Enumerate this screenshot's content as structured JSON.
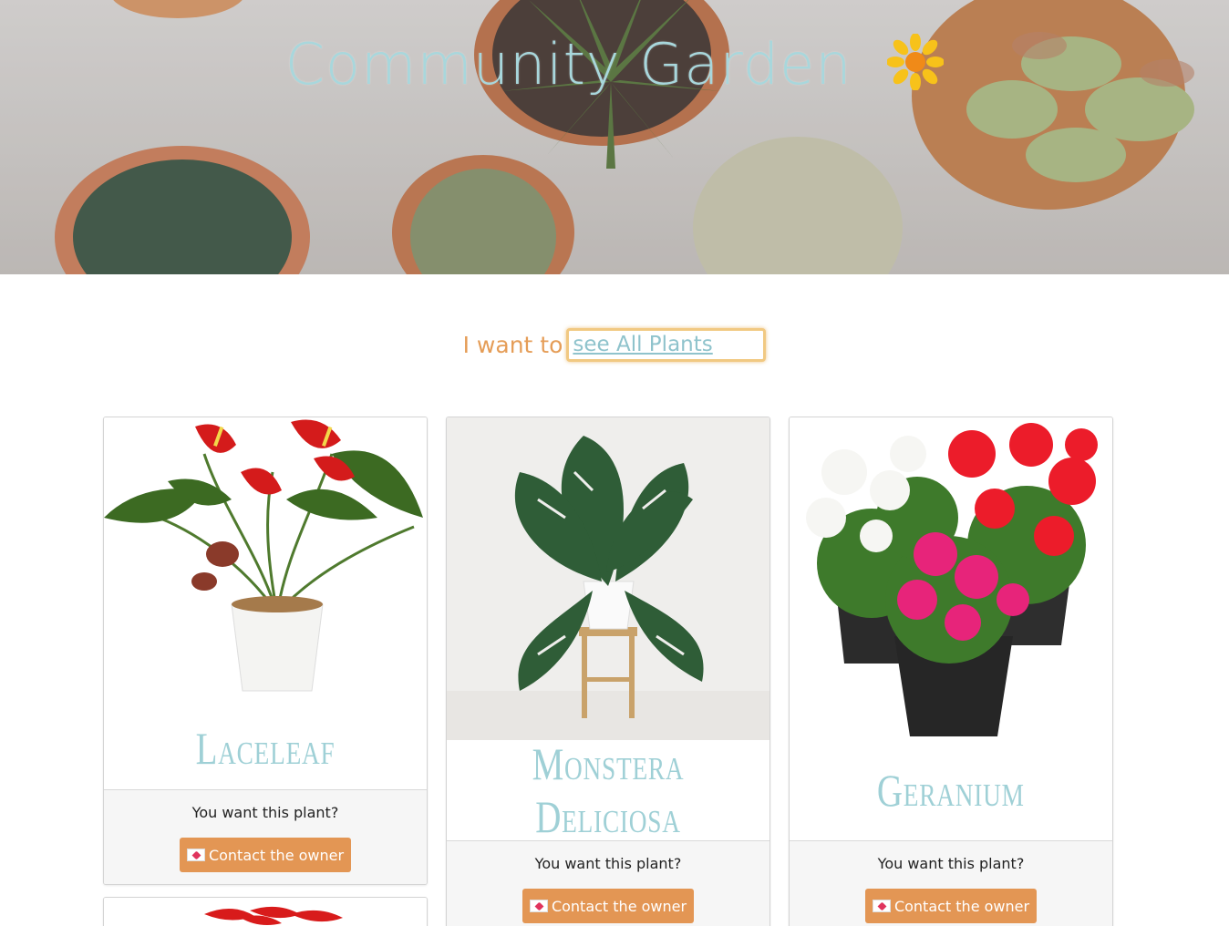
{
  "hero": {
    "title": "Community Garden",
    "icon": "sunflower-icon"
  },
  "filter": {
    "prefix": "I want to",
    "selected": "see All Plants"
  },
  "cards": [
    {
      "name": "Laceleaf",
      "question": "You want this plant?",
      "button": "Contact the owner"
    },
    {
      "name": "Monstera Deliciosa",
      "question": "You want this plant?",
      "button": "Contact the owner"
    },
    {
      "name": "Geranium",
      "question": "You want this plant?",
      "button": "Contact the owner"
    }
  ],
  "colors": {
    "accent": "#e39654",
    "title": "#a8d7dc",
    "plant_name": "#9fd0d6",
    "filter_label": "#e59d57"
  }
}
